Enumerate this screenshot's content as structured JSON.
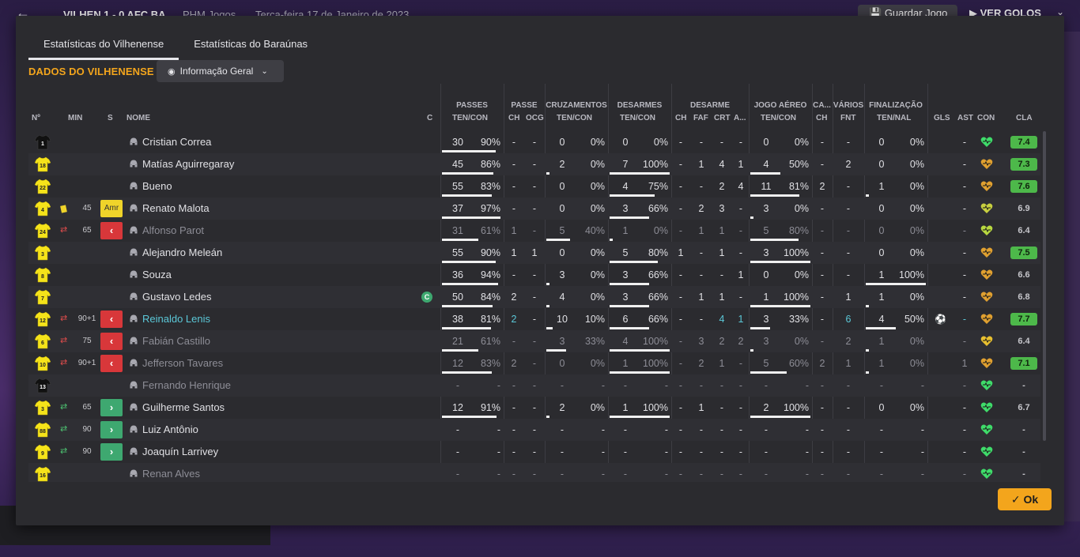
{
  "background": {
    "score": "VILHEN 1 - 0 AFC BA",
    "org": "PHM Jogos",
    "date": "Terça-feira 17 de Janeiro de 2023",
    "save_label": "Guardar Jogo",
    "goals_label": "VER GOLOS"
  },
  "tabs": [
    {
      "label": "Estatísticas do Vilhenense",
      "active": true
    },
    {
      "label": "Estatísticas do Baraúnas",
      "active": false
    }
  ],
  "section_title": "DADOS DO VILHENENSE",
  "view_dropdown": {
    "value": "Informação Geral"
  },
  "groups": {
    "passes": "PASSES",
    "passe": "PASSE",
    "cruz": "CRUZAMENTOS",
    "desarmes": "DESARMES",
    "desarme": "DESARME",
    "aereo": "JOGO AÉREO",
    "ca": "CA...",
    "varios": "VÁRIOS",
    "final": "FINALIZAÇÃO"
  },
  "columns": {
    "no": "Nº",
    "min": "MIN",
    "s": "S",
    "nome": "NOME",
    "c": "C",
    "p_tc": "TEN/CON",
    "pa_ch": "CH",
    "pa_ocg": "OCG",
    "cr_tc": "TEN/CON",
    "de_tc": "TEN/CON",
    "d_ch": "CH",
    "d_faf": "FAF",
    "d_crt": "CRT",
    "d_a": "A...",
    "ae_tc": "TEN/CON",
    "ca_ch": "CH",
    "fnt": "FNT",
    "fi_tn": "TEN/NAL",
    "gls": "GLS",
    "ast": "AST",
    "con": "CON",
    "cla": "CLA"
  },
  "rows": [
    {
      "no": "1",
      "gk": true,
      "min": "",
      "s": "",
      "name": "Cristian Correa",
      "c": "",
      "p_t": "30",
      "p_p": "90%",
      "pa_ch": "-",
      "pa_ocg": "-",
      "cr_t": "0",
      "cr_p": "0%",
      "de_t": "0",
      "de_p": "0%",
      "d_ch": "-",
      "d_faf": "-",
      "d_crt": "-",
      "d_a": "-",
      "ae_t": "0",
      "ae_p": "0%",
      "ca_ch": "-",
      "fnt": "-",
      "fi_t": "0",
      "fi_p": "0%",
      "gls": "",
      "ast": "-",
      "con_color": "#3fdc6a",
      "cla": "7.4",
      "cla_good": true,
      "p_bar": 0.9,
      "cr_bar": 0,
      "de_bar": 0,
      "ae_bar": 0,
      "fi_bar": 0
    },
    {
      "no": "18",
      "min": "",
      "s": "",
      "name": "Matías Aguirregaray",
      "c": "",
      "p_t": "45",
      "p_p": "86%",
      "pa_ch": "-",
      "pa_ocg": "-",
      "cr_t": "2",
      "cr_p": "0%",
      "de_t": "7",
      "de_p": "100%",
      "d_ch": "-",
      "d_faf": "1",
      "d_crt": "4",
      "d_a": "1",
      "ae_t": "4",
      "ae_p": "50%",
      "ca_ch": "-",
      "fnt": "2",
      "fi_t": "0",
      "fi_p": "0%",
      "gls": "",
      "ast": "-",
      "con_color": "#e0a030",
      "cla": "7.3",
      "cla_good": true,
      "p_bar": 0.86,
      "cr_bar": 0,
      "de_bar": 1,
      "ae_bar": 0.5,
      "fi_bar": 0
    },
    {
      "no": "22",
      "min": "",
      "s": "",
      "name": "Bueno",
      "c": "",
      "p_t": "55",
      "p_p": "83%",
      "pa_ch": "-",
      "pa_ocg": "-",
      "cr_t": "0",
      "cr_p": "0%",
      "de_t": "4",
      "de_p": "75%",
      "d_ch": "-",
      "d_faf": "-",
      "d_crt": "2",
      "d_a": "4",
      "ae_t": "11",
      "ae_p": "81%",
      "ca_ch": "2",
      "fnt": "-",
      "fi_t": "1",
      "fi_p": "0%",
      "gls": "",
      "ast": "-",
      "con_color": "#e0a030",
      "cla": "7.6",
      "cla_good": true,
      "p_bar": 0.83,
      "cr_bar": 0,
      "de_bar": 0.75,
      "ae_bar": 0.81,
      "fi_bar": 0
    },
    {
      "no": "4",
      "min": "45",
      "s": "Amr",
      "yellow": true,
      "name": "Renato Malota",
      "c": "",
      "p_t": "37",
      "p_p": "97%",
      "pa_ch": "-",
      "pa_ocg": "-",
      "cr_t": "0",
      "cr_p": "0%",
      "de_t": "3",
      "de_p": "66%",
      "d_ch": "-",
      "d_faf": "2",
      "d_crt": "3",
      "d_a": "-",
      "ae_t": "3",
      "ae_p": "0%",
      "ca_ch": "-",
      "fnt": "-",
      "fi_t": "0",
      "fi_p": "0%",
      "gls": "",
      "ast": "-",
      "con_color": "#c8d040",
      "cla": "6.9",
      "cla_good": false,
      "p_bar": 0.97,
      "cr_bar": 0,
      "de_bar": 0.66,
      "ae_bar": 0,
      "fi_bar": 0
    },
    {
      "no": "24",
      "min": "65",
      "sub": "out",
      "name": "Alfonso Parot",
      "dim": true,
      "c": "",
      "p_t": "31",
      "p_p": "61%",
      "pa_ch": "1",
      "pa_ocg": "-",
      "cr_t": "5",
      "cr_p": "40%",
      "de_t": "1",
      "de_p": "0%",
      "d_ch": "-",
      "d_faf": "1",
      "d_crt": "1",
      "d_a": "-",
      "ae_t": "5",
      "ae_p": "80%",
      "ca_ch": "-",
      "fnt": "-",
      "fi_t": "0",
      "fi_p": "0%",
      "gls": "",
      "ast": "-",
      "con_color": "#b8d840",
      "cla": "6.4",
      "cla_good": false,
      "p_bar": 0.61,
      "cr_bar": 0.4,
      "de_bar": 0,
      "ae_bar": 0.8,
      "fi_bar": 0
    },
    {
      "no": "3",
      "min": "",
      "s": "",
      "name": "Alejandro Meleán",
      "c": "",
      "p_t": "55",
      "p_p": "90%",
      "pa_ch": "1",
      "pa_ocg": "1",
      "cr_t": "0",
      "cr_p": "0%",
      "de_t": "5",
      "de_p": "80%",
      "d_ch": "1",
      "d_faf": "-",
      "d_crt": "1",
      "d_a": "-",
      "ae_t": "3",
      "ae_p": "100%",
      "ca_ch": "-",
      "fnt": "-",
      "fi_t": "0",
      "fi_p": "0%",
      "gls": "",
      "ast": "-",
      "con_color": "#e0a030",
      "cla": "7.5",
      "cla_good": true,
      "p_bar": 0.9,
      "cr_bar": 0,
      "de_bar": 0.8,
      "ae_bar": 1,
      "fi_bar": 0
    },
    {
      "no": "8",
      "min": "",
      "s": "",
      "name": "Souza",
      "c": "",
      "p_t": "36",
      "p_p": "94%",
      "pa_ch": "-",
      "pa_ocg": "-",
      "cr_t": "3",
      "cr_p": "0%",
      "de_t": "3",
      "de_p": "66%",
      "d_ch": "-",
      "d_faf": "-",
      "d_crt": "-",
      "d_a": "1",
      "ae_t": "0",
      "ae_p": "0%",
      "ca_ch": "-",
      "fnt": "-",
      "fi_t": "1",
      "fi_p": "100%",
      "gls": "",
      "ast": "-",
      "con_color": "#e0a030",
      "cla": "6.6",
      "cla_good": false,
      "p_bar": 0.94,
      "cr_bar": 0,
      "de_bar": 0.66,
      "ae_bar": 0,
      "fi_bar": 1
    },
    {
      "no": "7",
      "min": "",
      "s": "",
      "name": "Gustavo Ledes",
      "c": "C",
      "p_t": "50",
      "p_p": "84%",
      "pa_ch": "2",
      "pa_ocg": "-",
      "cr_t": "4",
      "cr_p": "0%",
      "de_t": "3",
      "de_p": "66%",
      "d_ch": "-",
      "d_faf": "1",
      "d_crt": "1",
      "d_a": "-",
      "ae_t": "1",
      "ae_p": "100%",
      "ca_ch": "-",
      "fnt": "1",
      "fi_t": "1",
      "fi_p": "0%",
      "gls": "",
      "ast": "-",
      "con_color": "#e0a030",
      "cla": "6.8",
      "cla_good": false,
      "p_bar": 0.84,
      "cr_bar": 0,
      "de_bar": 0.66,
      "ae_bar": 1,
      "fi_bar": 0
    },
    {
      "no": "12",
      "min": "90+1",
      "sub": "out",
      "name": "Reinaldo Lenis",
      "hl": true,
      "c": "",
      "p_t": "38",
      "p_p": "81%",
      "pa_ch": "2",
      "pa_ocg": "-",
      "cr_t": "10",
      "cr_p": "10%",
      "de_t": "6",
      "de_p": "66%",
      "d_ch": "-",
      "d_faf": "-",
      "d_crt": "4",
      "d_a": "1",
      "ae_t": "3",
      "ae_p": "33%",
      "ca_ch": "-",
      "fnt": "6",
      "fi_t": "4",
      "fi_p": "50%",
      "gls": "ball",
      "ast": "-",
      "con_color": "#e0a030",
      "cla": "7.7",
      "cla_good": true,
      "p_bar": 0.81,
      "cr_bar": 0.1,
      "de_bar": 0.66,
      "ae_bar": 0.33,
      "fi_bar": 0.5
    },
    {
      "no": "6",
      "min": "75",
      "sub": "out",
      "name": "Fabián Castillo",
      "dim": true,
      "c": "",
      "p_t": "21",
      "p_p": "61%",
      "pa_ch": "-",
      "pa_ocg": "-",
      "cr_t": "3",
      "cr_p": "33%",
      "de_t": "4",
      "de_p": "100%",
      "d_ch": "-",
      "d_faf": "3",
      "d_crt": "2",
      "d_a": "2",
      "ae_t": "3",
      "ae_p": "0%",
      "ca_ch": "-",
      "fnt": "2",
      "fi_t": "1",
      "fi_p": "0%",
      "gls": "",
      "ast": "-",
      "con_color": "#e8c030",
      "cla": "6.4",
      "cla_good": false,
      "p_bar": 0.61,
      "cr_bar": 0.33,
      "de_bar": 1,
      "ae_bar": 0,
      "fi_bar": 0
    },
    {
      "no": "10",
      "min": "90+1",
      "sub": "out",
      "name": "Jefferson Tavares",
      "dim": true,
      "c": "",
      "p_t": "12",
      "p_p": "83%",
      "pa_ch": "2",
      "pa_ocg": "-",
      "cr_t": "0",
      "cr_p": "0%",
      "de_t": "1",
      "de_p": "100%",
      "d_ch": "-",
      "d_faf": "2",
      "d_crt": "1",
      "d_a": "-",
      "ae_t": "5",
      "ae_p": "60%",
      "ca_ch": "2",
      "fnt": "1",
      "fi_t": "1",
      "fi_p": "0%",
      "gls": "",
      "ast": "1",
      "con_color": "#e0a030",
      "cla": "7.1",
      "cla_good": true,
      "p_bar": 0.83,
      "cr_bar": 0,
      "de_bar": 1,
      "ae_bar": 0.6,
      "fi_bar": 0
    },
    {
      "no": "13",
      "gk": true,
      "min": "",
      "s": "",
      "name": "Fernando Henrique",
      "dim": true,
      "c": "",
      "p_t": "-",
      "p_p": "-",
      "pa_ch": "-",
      "pa_ocg": "-",
      "cr_t": "-",
      "cr_p": "-",
      "de_t": "-",
      "de_p": "-",
      "d_ch": "-",
      "d_faf": "-",
      "d_crt": "-",
      "d_a": "-",
      "ae_t": "-",
      "ae_p": "-",
      "ca_ch": "-",
      "fnt": "-",
      "fi_t": "-",
      "fi_p": "-",
      "gls": "",
      "ast": "-",
      "con_color": "#3fdc6a",
      "cla": "-",
      "cla_good": false,
      "p_bar": 0,
      "cr_bar": 0,
      "de_bar": 0,
      "ae_bar": 0,
      "fi_bar": 0
    },
    {
      "no": "3",
      "min": "65",
      "sub": "in",
      "name": "Guilherme Santos",
      "c": "",
      "p_t": "12",
      "p_p": "91%",
      "pa_ch": "-",
      "pa_ocg": "-",
      "cr_t": "2",
      "cr_p": "0%",
      "de_t": "1",
      "de_p": "100%",
      "d_ch": "-",
      "d_faf": "1",
      "d_crt": "-",
      "d_a": "-",
      "ae_t": "2",
      "ae_p": "100%",
      "ca_ch": "-",
      "fnt": "-",
      "fi_t": "0",
      "fi_p": "0%",
      "gls": "",
      "ast": "-",
      "con_color": "#3fdc6a",
      "cla": "6.7",
      "cla_good": false,
      "p_bar": 0.91,
      "cr_bar": 0,
      "de_bar": 1,
      "ae_bar": 1,
      "fi_bar": 0
    },
    {
      "no": "88",
      "min": "90",
      "sub": "in",
      "name": "Luiz Antônio",
      "c": "",
      "p_t": "-",
      "p_p": "-",
      "pa_ch": "-",
      "pa_ocg": "-",
      "cr_t": "-",
      "cr_p": "-",
      "de_t": "-",
      "de_p": "-",
      "d_ch": "-",
      "d_faf": "-",
      "d_crt": "-",
      "d_a": "-",
      "ae_t": "-",
      "ae_p": "-",
      "ca_ch": "-",
      "fnt": "-",
      "fi_t": "-",
      "fi_p": "-",
      "gls": "",
      "ast": "-",
      "con_color": "#3fdc6a",
      "cla": "-",
      "cla_good": false,
      "p_bar": 0,
      "cr_bar": 0,
      "de_bar": 0,
      "ae_bar": 0,
      "fi_bar": 0
    },
    {
      "no": "9",
      "min": "90",
      "sub": "in",
      "name": "Joaquín Larrivey",
      "c": "",
      "p_t": "-",
      "p_p": "-",
      "pa_ch": "-",
      "pa_ocg": "-",
      "cr_t": "-",
      "cr_p": "-",
      "de_t": "-",
      "de_p": "-",
      "d_ch": "-",
      "d_faf": "-",
      "d_crt": "-",
      "d_a": "-",
      "ae_t": "-",
      "ae_p": "-",
      "ca_ch": "-",
      "fnt": "-",
      "fi_t": "-",
      "fi_p": "-",
      "gls": "",
      "ast": "-",
      "con_color": "#3fdc6a",
      "cla": "-",
      "cla_good": false,
      "p_bar": 0,
      "cr_bar": 0,
      "de_bar": 0,
      "ae_bar": 0,
      "fi_bar": 0
    },
    {
      "no": "16",
      "min": "",
      "s": "",
      "name": "Renan Alves",
      "dim": true,
      "c": "",
      "p_t": "-",
      "p_p": "-",
      "pa_ch": "-",
      "pa_ocg": "-",
      "cr_t": "-",
      "cr_p": "-",
      "de_t": "-",
      "de_p": "-",
      "d_ch": "-",
      "d_faf": "-",
      "d_crt": "-",
      "d_a": "-",
      "ae_t": "-",
      "ae_p": "-",
      "ca_ch": "-",
      "fnt": "-",
      "fi_t": "-",
      "fi_p": "-",
      "gls": "",
      "ast": "-",
      "con_color": "#3fdc6a",
      "cla": "-",
      "cla_good": false,
      "p_bar": 0,
      "cr_bar": 0,
      "de_bar": 0,
      "ae_bar": 0,
      "fi_bar": 0
    }
  ],
  "ok_label": "Ok",
  "colors": {
    "accent": "#f3a51c",
    "shirt": "#f5e31a",
    "gk_shirt": "#111111",
    "sub_out": "#d8373a",
    "sub_in": "#3ea870"
  }
}
